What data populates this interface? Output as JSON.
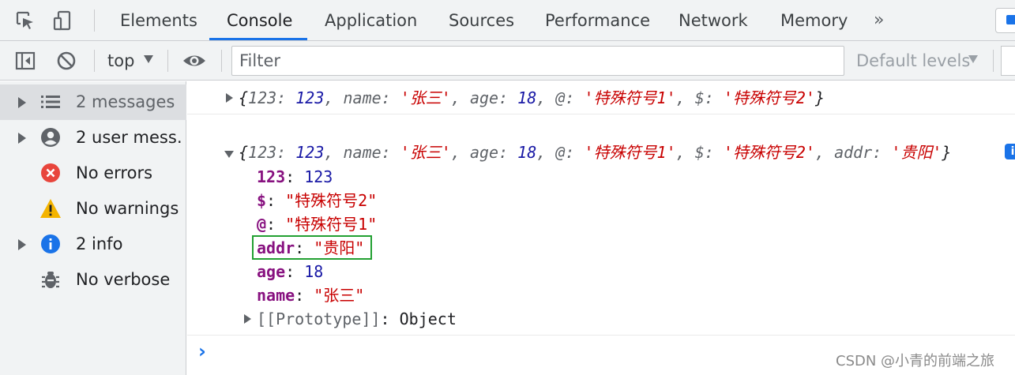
{
  "tabs": [
    {
      "label": "Elements"
    },
    {
      "label": "Console"
    },
    {
      "label": "Application"
    },
    {
      "label": "Sources"
    },
    {
      "label": "Performance"
    },
    {
      "label": "Network"
    },
    {
      "label": "Memory"
    }
  ],
  "active_tab": "Console",
  "more_tabs_icon": "»",
  "toolbar": {
    "context": "top",
    "filter_placeholder": "Filter",
    "levels": "Default levels"
  },
  "sidebar": {
    "items": [
      {
        "label": "2 messages",
        "icon": "list-icon",
        "expandable": true,
        "selected": true
      },
      {
        "label": "2 user mess…",
        "icon": "user-icon",
        "expandable": true
      },
      {
        "label": "No errors",
        "icon": "error-icon",
        "expandable": false
      },
      {
        "label": "No warnings",
        "icon": "warning-icon",
        "expandable": false
      },
      {
        "label": "2 info",
        "icon": "info-icon",
        "expandable": true
      },
      {
        "label": "No verbose",
        "icon": "bug-icon",
        "expandable": false
      }
    ]
  },
  "console": {
    "message1": {
      "open": "{",
      "close": "}",
      "entries": [
        {
          "key": "123",
          "value": "123",
          "type": "number"
        },
        {
          "key": "name",
          "value": "'张三'",
          "type": "string"
        },
        {
          "key": "age",
          "value": "18",
          "type": "number"
        },
        {
          "key": "@",
          "value": "'特殊符号1'",
          "type": "string"
        },
        {
          "key": "$",
          "value": "'特殊符号2'",
          "type": "string"
        }
      ]
    },
    "message2": {
      "open": "{",
      "close": "}",
      "entries": [
        {
          "key": "123",
          "value": "123",
          "type": "number"
        },
        {
          "key": "name",
          "value": "'张三'",
          "type": "string"
        },
        {
          "key": "age",
          "value": "18",
          "type": "number"
        },
        {
          "key": "@",
          "value": "'特殊符号1'",
          "type": "string"
        },
        {
          "key": "$",
          "value": "'特殊符号2'",
          "type": "string"
        },
        {
          "key": "addr",
          "value": "'贵阳'",
          "type": "string"
        }
      ],
      "info_badge": "i",
      "properties": [
        {
          "key": "123",
          "value": "123",
          "type": "number"
        },
        {
          "key": "$",
          "value": "\"特殊符号2\"",
          "type": "string"
        },
        {
          "key": "@",
          "value": "\"特殊符号1\"",
          "type": "string"
        },
        {
          "key": "addr",
          "value": "\"贵阳\"",
          "type": "string",
          "highlighted": true
        },
        {
          "key": "age",
          "value": "18",
          "type": "number"
        },
        {
          "key": "name",
          "value": "\"张三\"",
          "type": "string"
        }
      ],
      "prototype": {
        "key": "[[Prototype]]",
        "value": "Object"
      }
    },
    "prompt": "›"
  },
  "watermark": "CSDN @小青的前端之旅",
  "colors": {
    "accent": "#1a73e8",
    "highlight_border": "#22a032",
    "string": "#c80000",
    "number": "#1a1aa6",
    "property_key": "#881280"
  }
}
